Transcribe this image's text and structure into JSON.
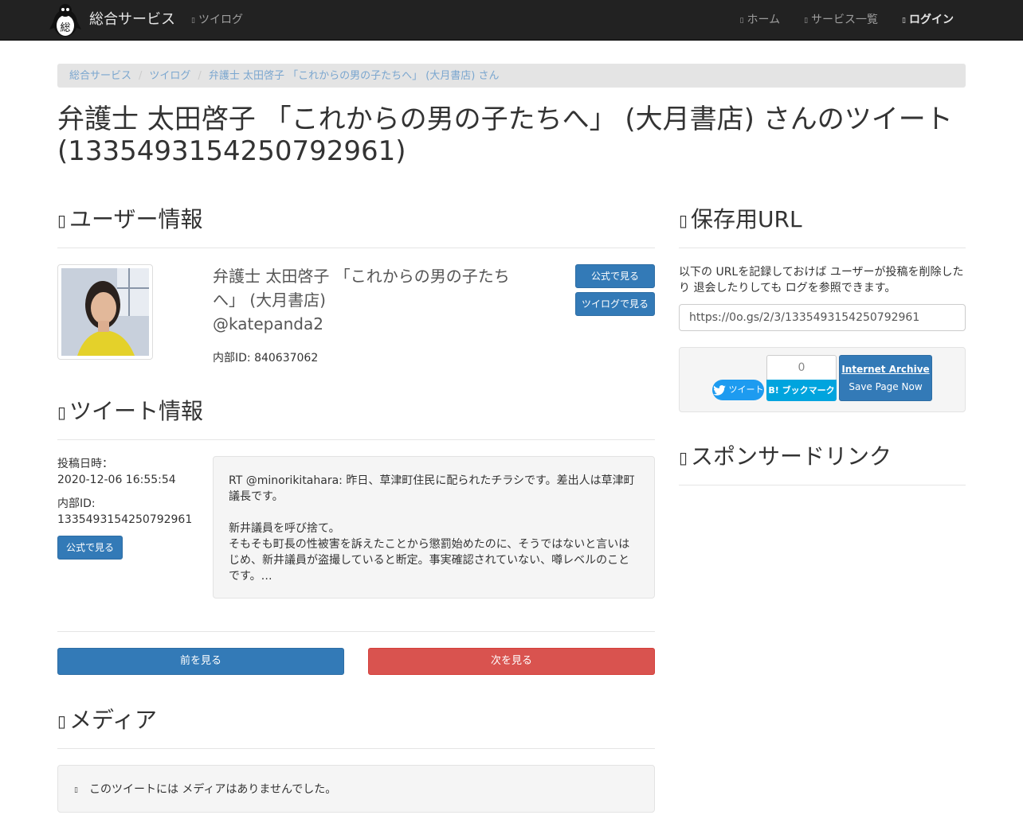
{
  "navbar": {
    "brand": "総合サービス",
    "logo_char": "総",
    "left_link": "ツイログ",
    "right_links": [
      "ホーム",
      "サービス一覧",
      "ログイン"
    ]
  },
  "breadcrumb": [
    "総合サービス",
    "ツイログ",
    "弁護士 太田啓子 「これからの男の子たちへ」 (大月書店) さん"
  ],
  "page_title": "弁護士 太田啓子 「これからの男の子たちへ」 (大月書店) さんのツイート (1335493154250792961)",
  "user_info": {
    "heading": "ユーザー情報",
    "name": "弁護士 太田啓子 「これからの男の子たちへ」 (大月書店)",
    "handle": "@katepanda2",
    "internal_id": "内部ID: 840637062",
    "official_button": "公式で見る",
    "twilog_button": "ツイログで見る"
  },
  "tweet_info": {
    "heading": "ツイート情報",
    "posted_label": "投稿日時：",
    "posted_value": "2020-12-06 16:55:54",
    "id_label": "内部ID:",
    "id_value": "1335493154250792961",
    "official_button": "公式で見る",
    "text": "RT @minorikitahara: 昨日、草津町住民に配られたチラシです。差出人は草津町議長です。\n\n新井議員を呼び捨て。\nそもそも町長の性被害を訴えたことから懲罰始めたのに、そうではないと言いはじめ、新井議員が盗撮していると断定。事実確認されていない、噂レベルのことです。…"
  },
  "pager": {
    "prev": "前を見る",
    "next": "次を見る"
  },
  "media": {
    "heading": "メディア",
    "empty_message": "このツイートには メディアはありませんでした。"
  },
  "save_url": {
    "heading": "保存用URL",
    "note": "以下の URLを記録しておけば ユーザーが投稿を削除したり 退会したりしても ログを参照できます。",
    "url": "https://0o.gs/2/3/1335493154250792961",
    "tweet_button": "ツイート",
    "hatena_count": "0",
    "hatena_button": "B! ブックマーク",
    "ia_title": "Internet Archive",
    "ia_sub": "Save Page Now"
  },
  "sponsor": {
    "heading": "スポンサードリンク"
  },
  "colors": {
    "navbar": "#222222",
    "primary": "#337ab7",
    "danger": "#d9534f",
    "hatena": "#00a4de",
    "twitter": "#1d9bf0"
  }
}
